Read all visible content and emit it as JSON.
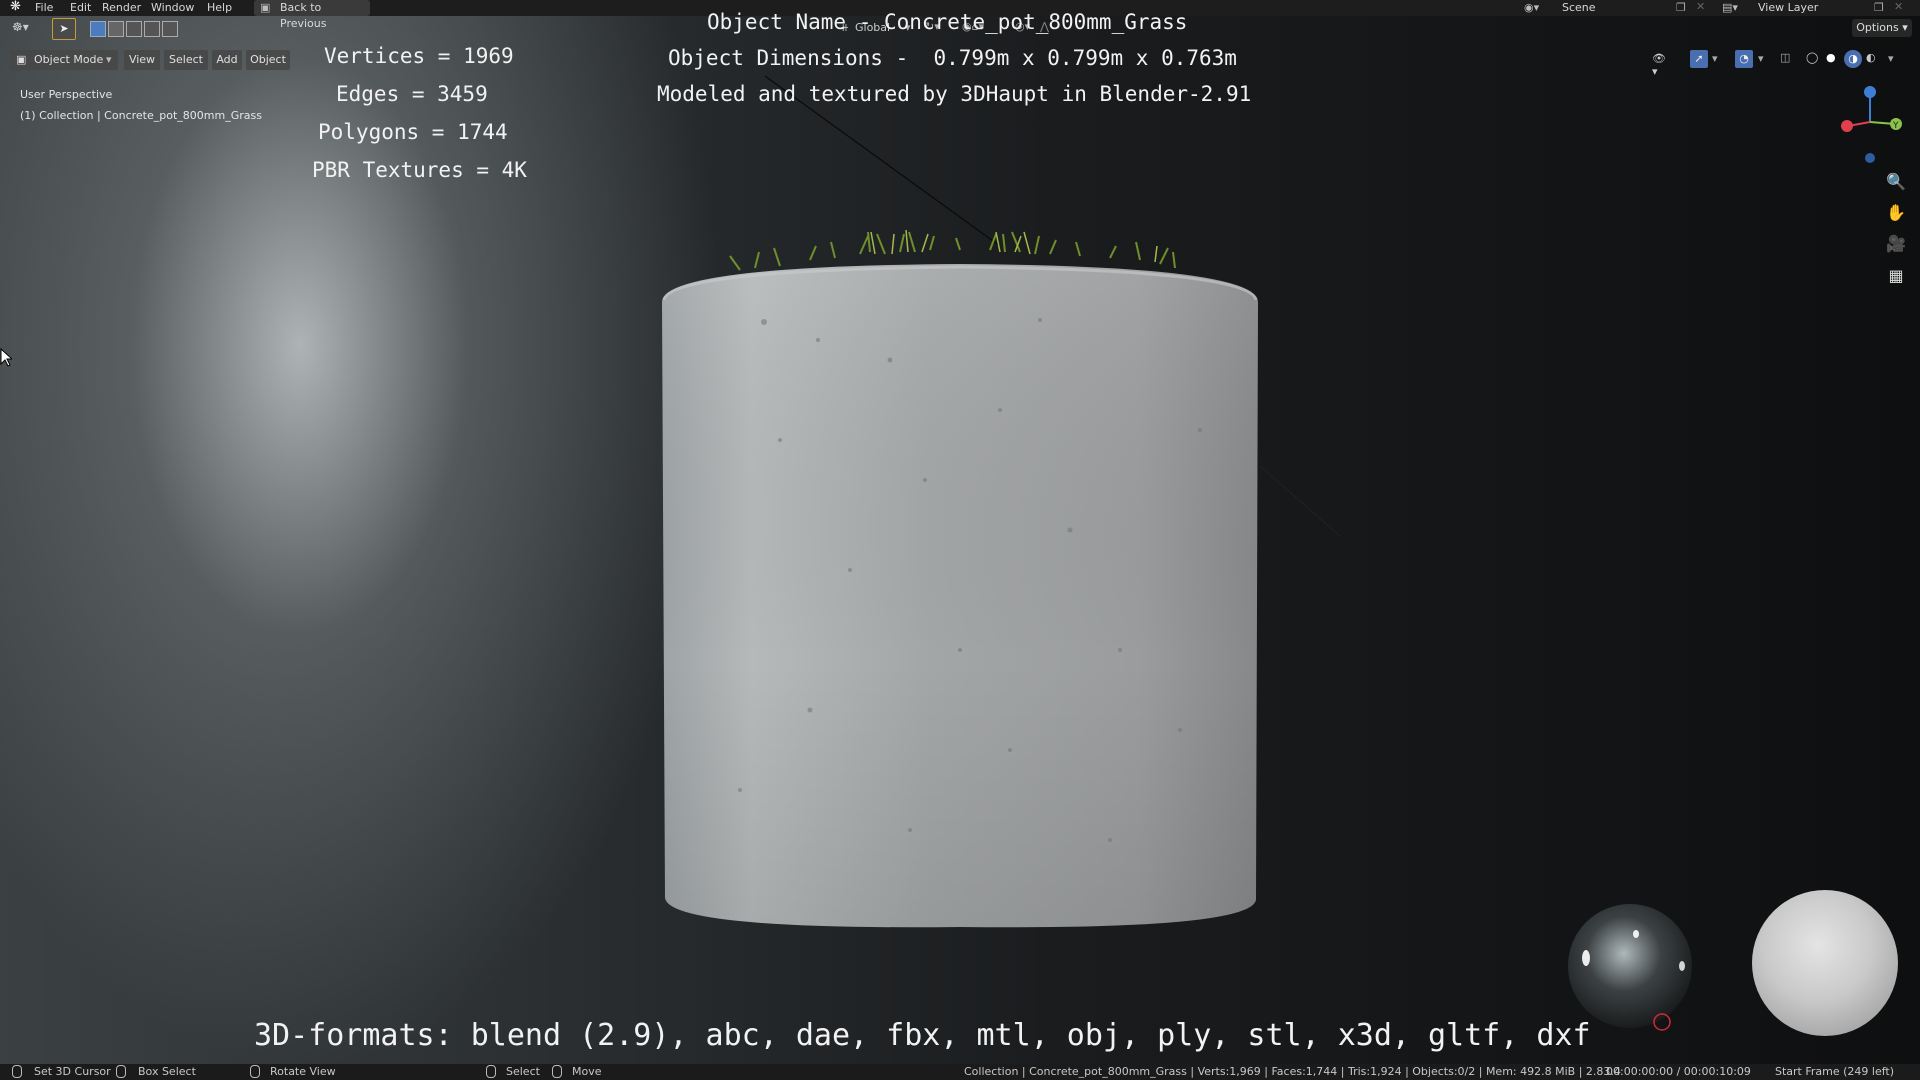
{
  "menu": {
    "items": [
      "File",
      "Edit",
      "Render",
      "Window",
      "Help"
    ],
    "back_button": "Back to Previous",
    "scene": "Scene",
    "view_layer": "View Layer"
  },
  "toolbar": {
    "transform_orientation": "Global",
    "options": "Options"
  },
  "header": {
    "mode": "Object Mode",
    "view": "View",
    "select": "Select",
    "add": "Add",
    "object": "Object"
  },
  "viewport": {
    "perspective": "User Perspective",
    "collection": "(1) Collection | Concrete_pot_800mm_Grass"
  },
  "stats": {
    "vertices": "Vertices = 1969",
    "edges": "Edges = 3459",
    "polygons": "Polygons = 1744",
    "textures": "PBR Textures = 4K"
  },
  "info": {
    "name": "Object Name - Concrete_pot_800mm_Grass",
    "dimensions": "Object Dimensions -  0.799m x 0.799m x 0.763m",
    "credits": "Modeled and textured by 3DHaupt in Blender-2.91"
  },
  "formats": "3D-formats: blend (2.9), abc, dae, fbx, mtl, obj, ply, stl, x3d, gltf, dxf",
  "gizmo": {
    "y_label": "Y"
  },
  "statusbar": {
    "set_cursor": "Set 3D Cursor",
    "box_select": "Box Select",
    "rotate_view": "Rotate View",
    "select": "Select",
    "move": "Move",
    "scene_stats": "Collection | Concrete_pot_800mm_Grass | Verts:1,969 | Faces:1,744 | Tris:1,924 | Objects:0/2 | Mem: 492.8 MiB | 2.83.4",
    "time": "00:00:00:00 / 00:00:10:09",
    "start_frame": "Start Frame (249 left)"
  },
  "colors": {
    "axis_x": "#e0404e",
    "axis_y": "#8bc34a",
    "axis_z": "#3d7fd6",
    "ui_dark": "#1d1d1d"
  }
}
